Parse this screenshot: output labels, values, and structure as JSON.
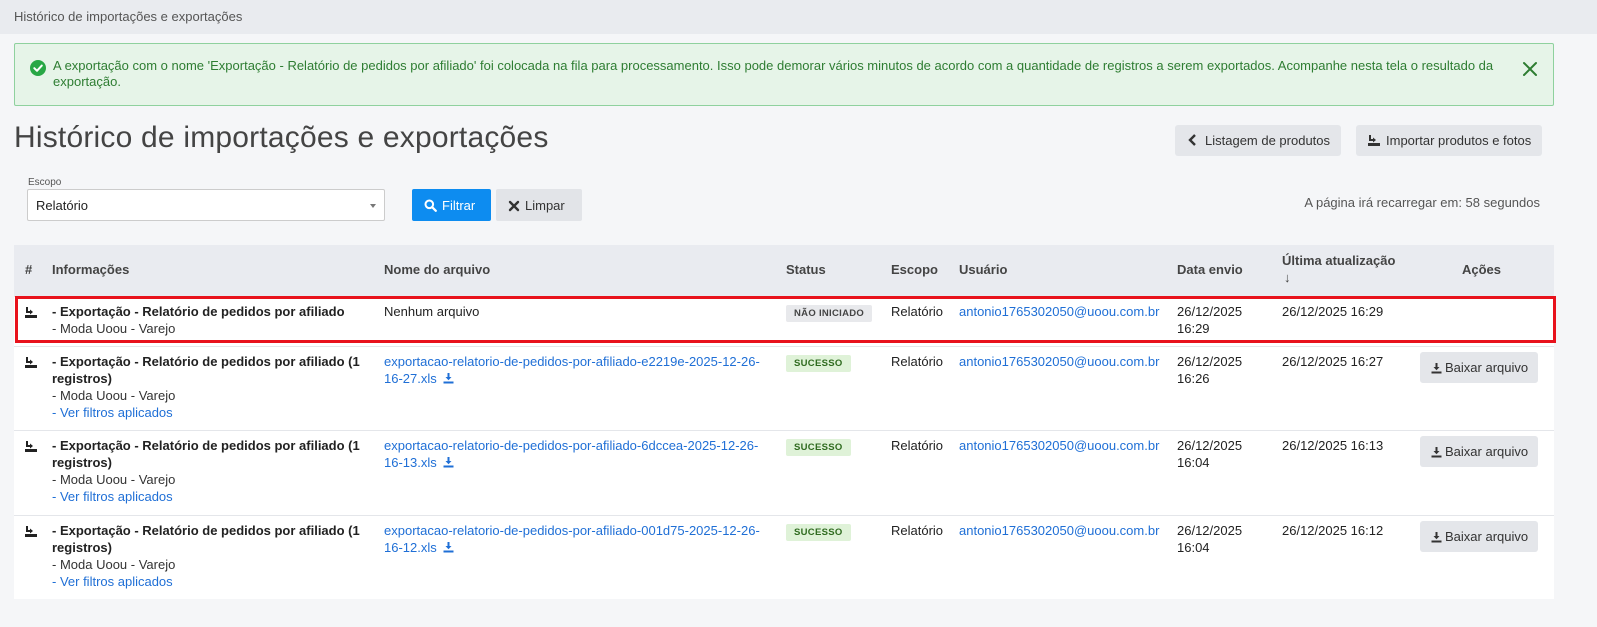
{
  "breadcrumb": "Histórico de importações e exportações",
  "alert": {
    "message": "A exportação com o nome 'Exportação - Relatório de pedidos por afiliado' foi colocada na fila para processamento. Isso pode demorar vários minutos de acordo com a quantidade de registros a serem exportados. Acompanhe nesta tela o resultado da exportação.",
    "icon": "check-circle-icon",
    "close_icon": "close-icon"
  },
  "page_title": "Histórico de importações e exportações",
  "header_buttons": {
    "list_products": "Listagem de produtos",
    "import_products": "Importar produtos e fotos"
  },
  "filter": {
    "scope_label": "Escopo",
    "scope_value": "Relatório",
    "filter_button": "Filtrar",
    "clear_button": "Limpar"
  },
  "reload_text": "A página irá recarregar em: 58 segundos",
  "table": {
    "headers": {
      "hash": "#",
      "info": "Informações",
      "file": "Nome do arquivo",
      "status": "Status",
      "scope": "Escopo",
      "user": "Usuário",
      "sent_date": "Data envio",
      "last_update": "Última atualização",
      "last_update_arrow": "↓",
      "actions": "Ações"
    },
    "rows": [
      {
        "title": "- Exportação - Relatório de pedidos por afiliado",
        "store": "- Moda Uoou - Varejo",
        "filters_link": "",
        "file_name": "Nenhum arquivo",
        "status": "NÃO INICIADO",
        "scope": "Relatório",
        "user": "antonio1765302050@uoou.com.br",
        "sent_date": "26/12/2025",
        "sent_time": "16:29",
        "last_update": "26/12/2025 16:29",
        "action": ""
      },
      {
        "title": "- Exportação - Relatório de pedidos por afiliado (1",
        "title2": "registros)",
        "store": "- Moda Uoou - Varejo",
        "filters_link": "- Ver filtros aplicados",
        "file_line1": "exportacao-relatorio-de-pedidos-por-afiliado-e2219e-2025-12-26-",
        "file_line2": "16-27.xls",
        "status": "SUCESSO",
        "scope": "Relatório",
        "user": "antonio1765302050@uoou.com.br",
        "sent_date": "26/12/2025",
        "sent_time": "16:26",
        "last_update": "26/12/2025 16:27",
        "action": "Baixar arquivo"
      },
      {
        "title": "- Exportação - Relatório de pedidos por afiliado (1",
        "title2": "registros)",
        "store": "- Moda Uoou - Varejo",
        "filters_link": "- Ver filtros aplicados",
        "file_line1": "exportacao-relatorio-de-pedidos-por-afiliado-6dccea-2025-12-26-",
        "file_line2": "16-13.xls",
        "status": "SUCESSO",
        "scope": "Relatório",
        "user": "antonio1765302050@uoou.com.br",
        "sent_date": "26/12/2025",
        "sent_time": "16:04",
        "last_update": "26/12/2025 16:13",
        "action": "Baixar arquivo"
      },
      {
        "title": "- Exportação - Relatório de pedidos por afiliado (1",
        "title2": "registros)",
        "store": "- Moda Uoou - Varejo",
        "filters_link": "- Ver filtros aplicados",
        "file_line1": "exportacao-relatorio-de-pedidos-por-afiliado-001d75-2025-12-26-",
        "file_line2": "16-12.xls",
        "status": "SUCESSO",
        "scope": "Relatório",
        "user": "antonio1765302050@uoou.com.br",
        "sent_date": "26/12/2025",
        "sent_time": "16:04",
        "last_update": "26/12/2025 16:12",
        "action": "Baixar arquivo"
      }
    ]
  },
  "colors": {
    "alert_text": "#2e7d32",
    "alert_bg": "#e6f4e8",
    "primary": "#0d8cf0",
    "link": "#1f6fd6",
    "highlight": "#e8121c"
  }
}
